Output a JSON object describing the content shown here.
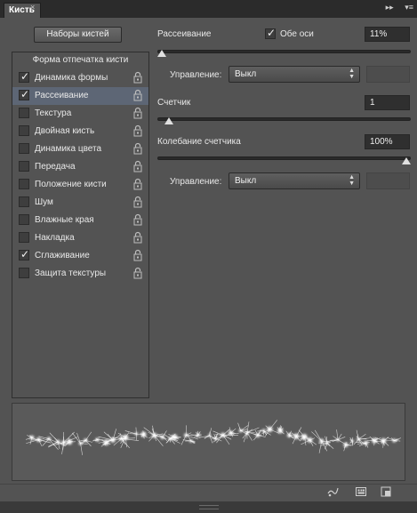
{
  "panel": {
    "tab_title": "Кисть",
    "tab_close": "×",
    "ctrl_expand": "▸▸",
    "ctrl_menu": "▾≡"
  },
  "presets_button": "Наборы кистей",
  "list": {
    "header": "Форма отпечатка кисти",
    "items": [
      {
        "label": "Динамика формы",
        "checked": true
      },
      {
        "label": "Рассеивание",
        "checked": true,
        "selected": true
      },
      {
        "label": "Текстура",
        "checked": false
      },
      {
        "label": "Двойная кисть",
        "checked": false
      },
      {
        "label": "Динамика цвета",
        "checked": false
      },
      {
        "label": "Передача",
        "checked": false
      },
      {
        "label": "Положение кисти",
        "checked": false
      },
      {
        "label": "Шум",
        "checked": false
      },
      {
        "label": "Влажные края",
        "checked": false
      },
      {
        "label": "Накладка",
        "checked": false
      },
      {
        "label": "Сглаживание",
        "checked": true
      },
      {
        "label": "Защита текстуры",
        "checked": false
      }
    ]
  },
  "scatter": {
    "label": "Рассеивание",
    "both_axes_label": "Обе оси",
    "both_axes_checked": true,
    "value": "11%",
    "slider_fraction": 0.0
  },
  "control1": {
    "label": "Управление:",
    "value": "Выкл"
  },
  "count": {
    "label": "Счетчик",
    "value": "1",
    "slider_fraction": 0.03
  },
  "count_jitter": {
    "label": "Колебание счетчика",
    "value": "100%",
    "slider_fraction": 1.0
  },
  "control2": {
    "label": "Управление:",
    "value": "Выкл"
  },
  "colors": {
    "panel_bg": "#535353",
    "selected_row": "#5d6675",
    "field_bg": "#2f2f2f"
  }
}
